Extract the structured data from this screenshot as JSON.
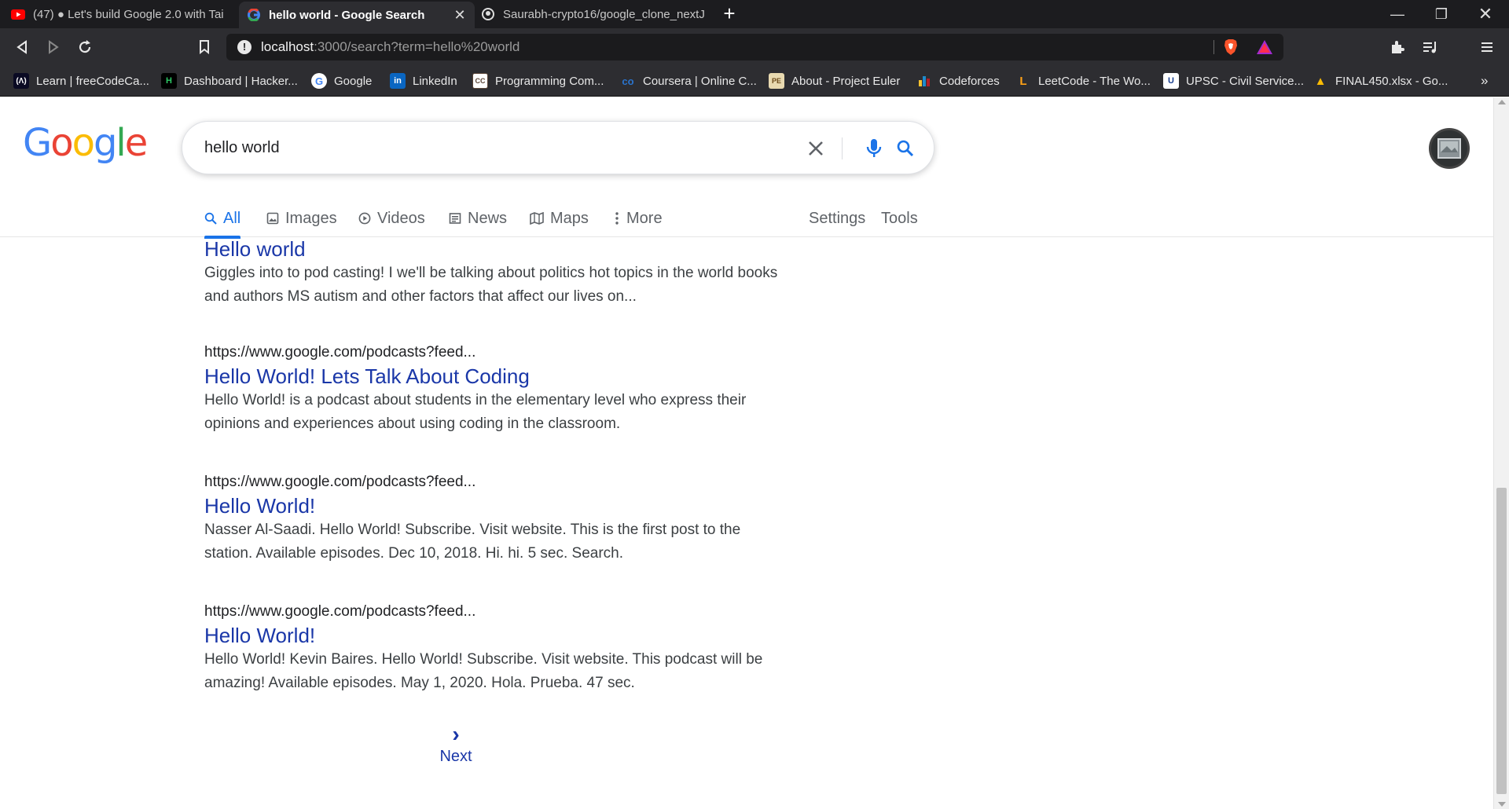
{
  "browser": {
    "tabs": [
      {
        "title": "(47) ● Let's build Google 2.0 with Tai",
        "icon": "youtube-icon",
        "active": false
      },
      {
        "title": "hello world - Google Search",
        "icon": "google-icon",
        "active": true,
        "close": "✕"
      },
      {
        "title": "Saurabh-crypto16/google_clone_nextJ",
        "icon": "github-icon",
        "active": false
      }
    ],
    "new_tab": "+",
    "address": {
      "host": "localhost",
      "path": ":3000/search?term=hello%20world"
    },
    "bookmarks": [
      {
        "label": "Learn | freeCodeCa...",
        "icon": "freecodecamp-icon",
        "badge": "(Λ)"
      },
      {
        "label": "Dashboard | Hacker...",
        "icon": "hackerrank-icon",
        "badge": "H"
      },
      {
        "label": "Google",
        "icon": "google-icon",
        "badge": "G"
      },
      {
        "label": "LinkedIn",
        "icon": "linkedin-icon",
        "badge": "in"
      },
      {
        "label": "Programming Com...",
        "icon": "codechef-icon",
        "badge": "CC"
      },
      {
        "label": "Coursera | Online C...",
        "icon": "coursera-icon",
        "badge": "co"
      },
      {
        "label": "About - Project Euler",
        "icon": "project-euler-icon",
        "badge": "PE"
      },
      {
        "label": "Codeforces",
        "icon": "codeforces-icon",
        "badge": "▐"
      },
      {
        "label": "LeetCode - The Wo...",
        "icon": "leetcode-icon",
        "badge": "L"
      },
      {
        "label": "UPSC - Civil Service...",
        "icon": "upsc-icon",
        "badge": "U"
      },
      {
        "label": "FINAL450.xlsx - Go...",
        "icon": "google-drive-icon",
        "badge": "▲"
      }
    ],
    "more_bookmarks": "»"
  },
  "search": {
    "query": "hello world",
    "tabs": [
      {
        "label": "All",
        "icon": "search-icon",
        "active": true
      },
      {
        "label": "Images",
        "icon": "image-icon"
      },
      {
        "label": "Videos",
        "icon": "play-icon"
      },
      {
        "label": "News",
        "icon": "newspaper-icon"
      },
      {
        "label": "Maps",
        "icon": "map-icon"
      },
      {
        "label": "More",
        "icon": "more-vert-icon"
      }
    ],
    "settings_label": "Settings",
    "tools_label": "Tools"
  },
  "results": [
    {
      "url": "",
      "title": "Hello world",
      "snippet": "Giggles into to pod casting! I we'll be talking about politics hot topics in the world books and authors MS autism and other factors that affect our lives on..."
    },
    {
      "url": "https://www.google.com/podcasts?feed...",
      "title": "Hello World! Lets Talk About Coding",
      "snippet": "Hello World! is a podcast about students in the elementary level who express their opinions and experiences about using coding in the classroom."
    },
    {
      "url": "https://www.google.com/podcasts?feed...",
      "title": "Hello World!",
      "snippet": "Nasser Al-Saadi. Hello World! Subscribe. Visit website. This is the first post to the station. Available episodes. Dec 10, 2018. Hi. hi. 5 sec. Search."
    },
    {
      "url": "https://www.google.com/podcasts?feed...",
      "title": "Hello World!",
      "snippet": "Hello World! Kevin Baires. Hello World! Subscribe. Visit website. This podcast will be amazing! Available episodes. May 1, 2020. Hola. Prueba. 47 sec."
    }
  ],
  "pagination": {
    "next_label": "Next",
    "next_arrow": "›"
  },
  "colors": {
    "link": "#1a37a8",
    "accent": "#1a73e8",
    "chrome": "#2d2d31"
  }
}
